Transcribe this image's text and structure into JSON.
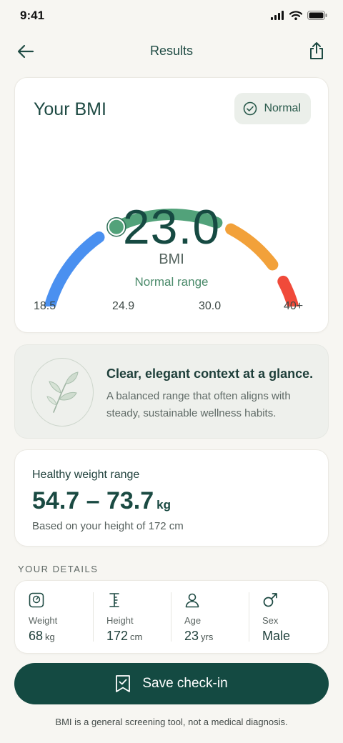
{
  "status_bar": {
    "time": "9:41"
  },
  "nav": {
    "title": "Results",
    "back_icon": "arrow-left-icon",
    "share_icon": "share-icon"
  },
  "bmi_card": {
    "title": "Your BMI",
    "badge_label": "Normal",
    "value": "23.0",
    "unit": "BMI",
    "range_label": "Normal range",
    "indicator_fraction": 0.33,
    "ticks": [
      "18.5",
      "24.9",
      "30.0",
      "40+"
    ],
    "colors": {
      "underweight": "#4a90f0",
      "normal": "#52a27a",
      "overweight": "#f2a13a",
      "obese": "#f04a3a"
    }
  },
  "context_card": {
    "title": "Clear, elegant context at a glance.",
    "text": "A balanced range that often aligns with steady, sustainable wellness habits."
  },
  "weight_card": {
    "title": "Healthy weight range",
    "value": "54.7 – 73.7",
    "unit": "kg",
    "note": "Based on your height of 172 cm"
  },
  "details": {
    "heading": "YOUR DETAILS",
    "items": [
      {
        "label": "Weight",
        "value": "68",
        "unit": "kg",
        "icon": "scale-icon"
      },
      {
        "label": "Height",
        "value": "172",
        "unit": "cm",
        "icon": "height-icon"
      },
      {
        "label": "Age",
        "value": "23",
        "unit": "yrs",
        "icon": "person-icon"
      },
      {
        "label": "Sex",
        "value": "Male",
        "unit": "",
        "icon": "male-icon"
      }
    ]
  },
  "save_button": {
    "label": "Save check-in"
  },
  "disclaimer": "BMI is a general screening tool, not a medical diagnosis.",
  "colors": {
    "primary": "#144a42",
    "accent": "#52a27a",
    "background": "#f7f6f2"
  }
}
